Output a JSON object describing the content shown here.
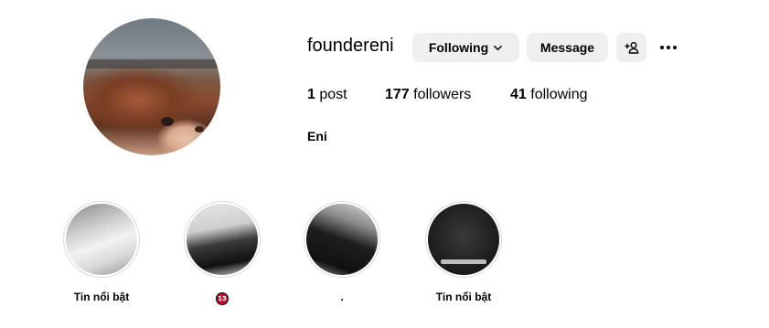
{
  "profile": {
    "username": "foundereni",
    "full_name": "Eni",
    "buttons": {
      "following_label": "Following",
      "message_label": "Message"
    },
    "stats": {
      "posts_count": "1",
      "posts_label": "post",
      "followers_count": "177",
      "followers_label": "followers",
      "following_count": "41",
      "following_label": "following"
    }
  },
  "highlights": [
    {
      "label": "Tin nổi bật"
    },
    {
      "label": "",
      "badge": "13"
    },
    {
      "label": "."
    },
    {
      "label": "Tin nổi bật"
    }
  ],
  "icons": [
    "chevron-down-icon",
    "add-user-icon",
    "more-options-icon"
  ],
  "colors": {
    "button_bg": "#efefef",
    "ring": "#dbdbdb",
    "badge": "#c8102e"
  }
}
